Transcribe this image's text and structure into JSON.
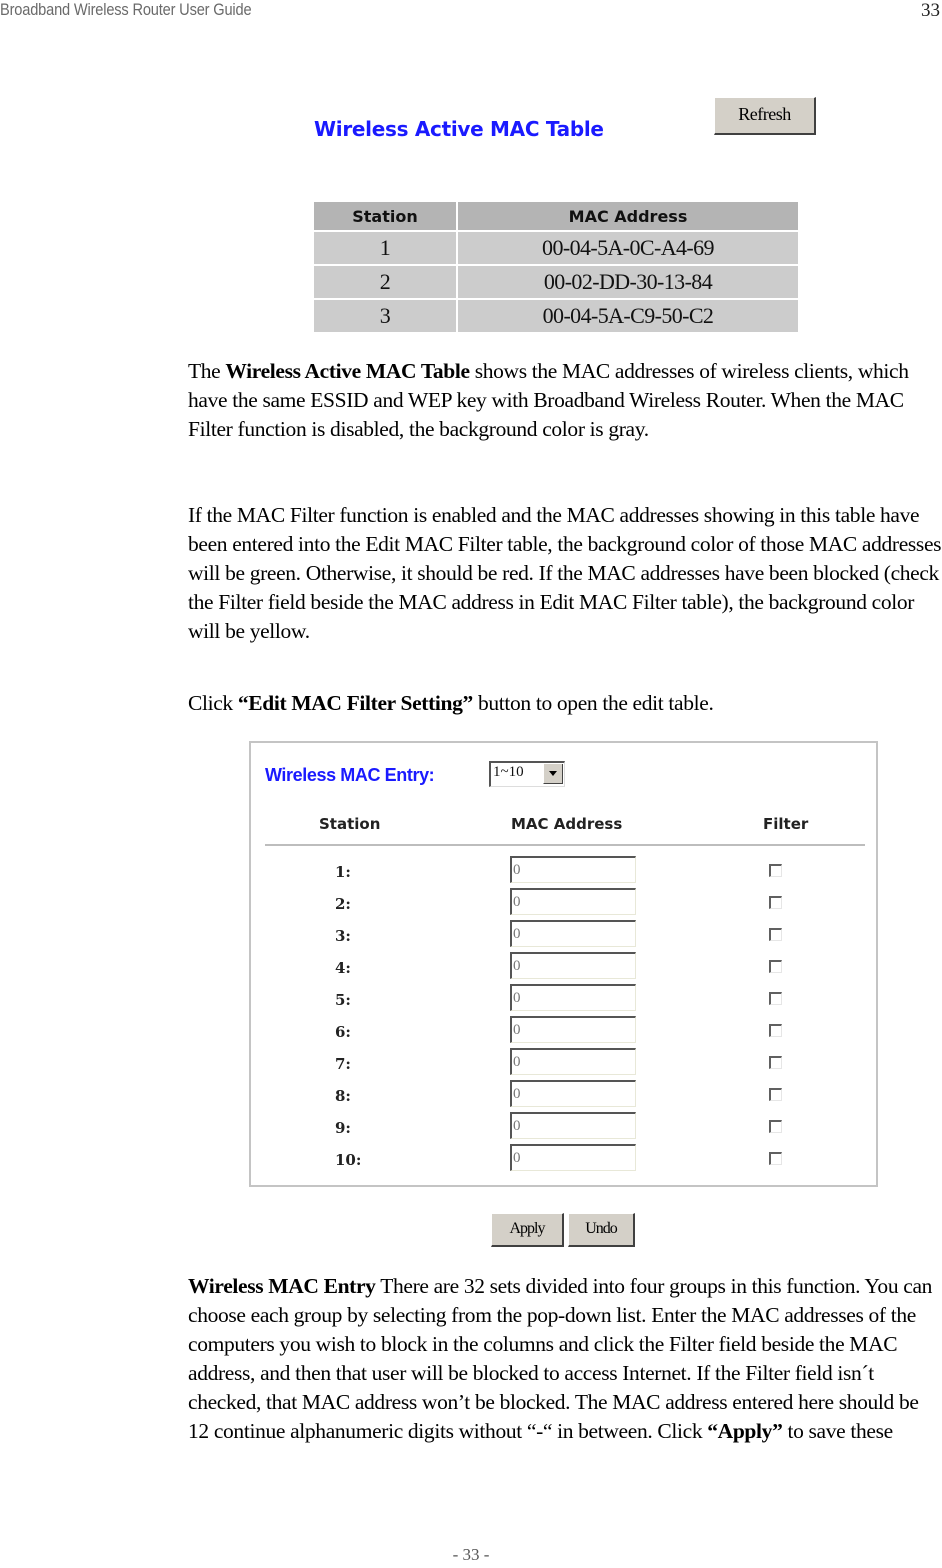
{
  "page_header": {
    "title": "Broadband Wireless Router User Guide",
    "page_number": "33"
  },
  "active_mac_table": {
    "title": "Wireless Active MAC Table",
    "refresh_label": "Refresh",
    "columns": [
      "Station",
      "MAC Address"
    ],
    "rows": [
      {
        "station": "1",
        "mac": "00-04-5A-0C-A4-69"
      },
      {
        "station": "2",
        "mac": "00-02-DD-30-13-84"
      },
      {
        "station": "3",
        "mac": "00-04-5A-C9-50-C2"
      }
    ]
  },
  "paragraphs": {
    "p1": {
      "prefix": "The ",
      "bold": "Wireless Active MAC Table",
      "text": " shows the MAC addresses of wireless clients, which have the same ESSID and WEP key with Broadband Wireless Router. When the MAC Filter function is disabled, the background color is gray."
    },
    "p2": {
      "text": "If the MAC Filter function is enabled and the MAC addresses showing in this table have been entered into the Edit MAC Filter table, the background color of those MAC addresses will be green. Otherwise, it should be red. If the MAC addresses have been blocked (check the Filter field beside the MAC address in Edit MAC Filter table), the background color will be yellow."
    },
    "p3": {
      "prefix": "Click ",
      "bold": "“Edit MAC Filter Setting”",
      "text": " button to open the edit table."
    },
    "p4": {
      "bold": "Wireless MAC Entry",
      "text": " There are 32 sets divided into four groups in this function. You can choose each group by selecting from the pop-down list. Enter the MAC addresses of the computers you wish to block in the columns and click the Filter field beside the MAC address, and then that user will be blocked to access Internet. If the Filter field isn´t checked, that MAC address won’t be blocked. The MAC address entered here should be 12 continue alphanumeric digits without “-“ in between. Click ",
      "bold2": "“Apply”",
      "suffix": " to save these"
    }
  },
  "mac_entry": {
    "title": "Wireless MAC Entry:",
    "group_select": {
      "selected": "1~10"
    },
    "columns": {
      "station": "Station",
      "mac": "MAC Address",
      "filter": "Filter"
    },
    "rows": [
      {
        "label": "1:",
        "value": "0",
        "filter": false
      },
      {
        "label": "2:",
        "value": "0",
        "filter": false
      },
      {
        "label": "3:",
        "value": "0",
        "filter": false
      },
      {
        "label": "4:",
        "value": "0",
        "filter": false
      },
      {
        "label": "5:",
        "value": "0",
        "filter": false
      },
      {
        "label": "6:",
        "value": "0",
        "filter": false
      },
      {
        "label": "7:",
        "value": "0",
        "filter": false
      },
      {
        "label": "8:",
        "value": "0",
        "filter": false
      },
      {
        "label": "9:",
        "value": "0",
        "filter": false
      },
      {
        "label": "10:",
        "value": "0",
        "filter": false
      }
    ],
    "apply_label": "Apply",
    "undo_label": "Undo"
  },
  "footer": {
    "page_label": "- 33 -"
  },
  "colors": {
    "title_blue": "#1a1aff",
    "table_header_bg": "#b4b4b4",
    "table_cell_bg": "#cccccc",
    "button_face": "#d4d0c8"
  }
}
